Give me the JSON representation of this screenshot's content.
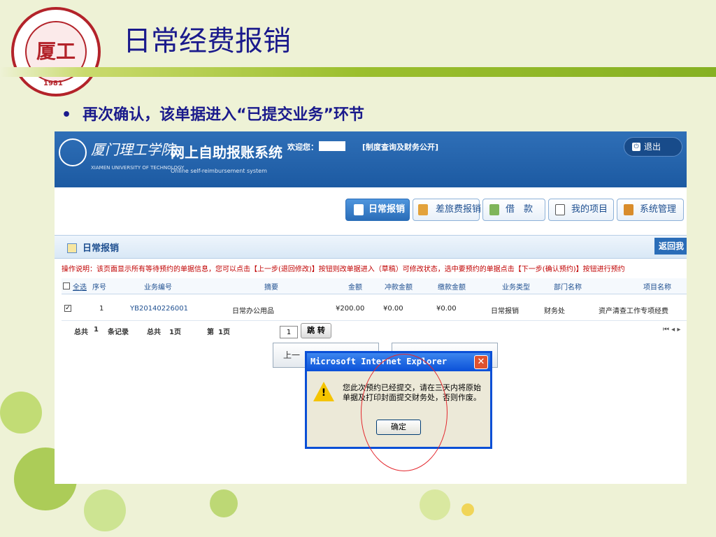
{
  "slide": {
    "title": "日常经费报销",
    "bullet": "再次确认，该单据进入“已提交业务”环节",
    "logo_year": "1981",
    "logo_ring_text": "XIAMEN UNIVERSITY OF TECHNOLOGY"
  },
  "app": {
    "school_cn": "厦门理工学院",
    "school_en": "XIAMEN UNIVERSITY OF TECHNOLOGY",
    "system_cn": "网上自助报账系统",
    "system_en": "Online self-reimbursement system",
    "welcome": "欢迎您：",
    "policy_link": "[制度查询及财务公开]",
    "exit_label": "退出"
  },
  "nav": {
    "tabs": [
      {
        "label": "日常报销",
        "active": true
      },
      {
        "label": "差旅费报销",
        "active": false
      },
      {
        "label": "借　款",
        "active": false
      },
      {
        "label": "我的项目",
        "active": false
      },
      {
        "label": "系统管理",
        "active": false
      }
    ]
  },
  "panel": {
    "title": "日常报销",
    "back_label": "返回我"
  },
  "instruction": "操作说明：该页面显示所有等待预约的单据信息，您可以点击【上一步(退回修改)】按钮则改单据进入（草稿）可修改状态，选中要预约的单据点击【下一步(确认预约)】按钮进行预约",
  "table": {
    "select_all": "全选",
    "headers": [
      "序号",
      "业务编号",
      "摘要",
      "金额",
      "冲款金额",
      "缴款金额",
      "业务类型",
      "部门名称",
      "项目名称"
    ],
    "rows": [
      {
        "checked": true,
        "index": "1",
        "biz_no": "YB20140226001",
        "summary": "日常办公用品",
        "amount": "¥200.00",
        "offset": "¥0.00",
        "payment": "¥0.00",
        "type": "日常报销",
        "dept": "财务处",
        "project": "资产清查工作专项经费"
      }
    ]
  },
  "pager": {
    "total_records_label": "总共",
    "total_records": "1",
    "records_unit": "条记录",
    "total_pages_label": "总共",
    "total_pages": "1页",
    "current_label": "第",
    "current_page": "1页",
    "input_value": "1",
    "jump_label": "跳 转",
    "arrows": "⏮ ◂ ▸"
  },
  "steps": {
    "prev_label": "上一",
    "next_label": ""
  },
  "dialog": {
    "title": "Microsoft Internet Explorer",
    "message": "您此次预约已经提交，请在三天内将原始单据及打印封面提交财务处，否则作废。",
    "ok_label": "确定"
  },
  "colors": {
    "slide_title": "#1a1a8c",
    "header_blue": "#2f6fb7",
    "instruction_red": "#c00000",
    "dialog_border": "#0a4fd6",
    "highlight_circle": "#e3262c"
  }
}
